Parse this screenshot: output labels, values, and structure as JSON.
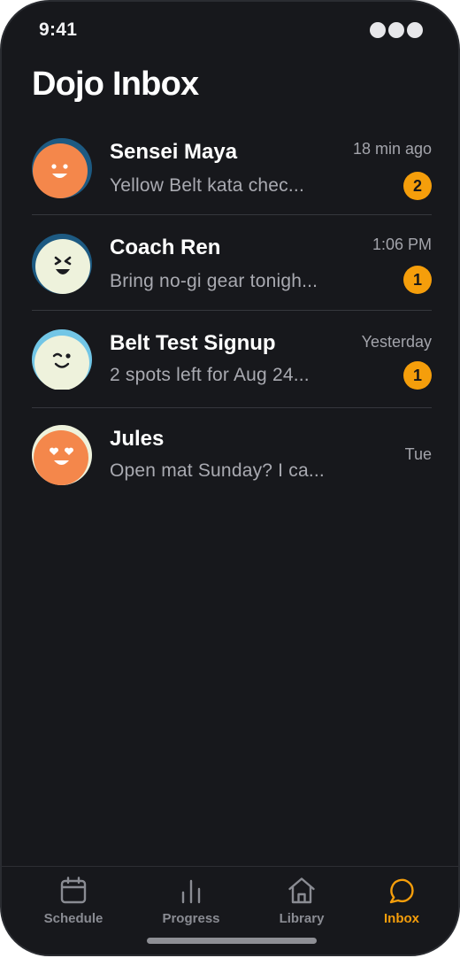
{
  "status_bar": {
    "time": "9:41"
  },
  "header": {
    "title": "Dojo Inbox"
  },
  "conversations": [
    {
      "name": "Sensei Maya",
      "preview": "Yellow Belt kata chec...",
      "time": "18 min ago",
      "unread": "2",
      "avatar": "smiling-face-icon"
    },
    {
      "name": "Coach Ren",
      "preview": "Bring no-gi gear tonigh...",
      "time": "1:06 PM",
      "unread": "1",
      "avatar": "laughing-face-icon"
    },
    {
      "name": "Belt Test Signup",
      "preview": "2 spots left for Aug 24...",
      "time": "Yesterday",
      "unread": "1",
      "avatar": "winking-face-icon"
    },
    {
      "name": "Jules",
      "preview": "Open mat Sunday? I ca...",
      "time": "Tue",
      "unread": "",
      "avatar": "heart-eyes-face-icon"
    }
  ],
  "tabbar": {
    "tabs": [
      {
        "label": "Schedule",
        "icon": "calendar-icon",
        "active": false
      },
      {
        "label": "Progress",
        "icon": "bar-chart-icon",
        "active": false
      },
      {
        "label": "Library",
        "icon": "home-icon",
        "active": false
      },
      {
        "label": "Inbox",
        "icon": "chat-bubble-icon",
        "active": true
      }
    ]
  },
  "colors": {
    "background": "#17181c",
    "accent": "#f59e0b",
    "avatar_orange": "#f4874b",
    "avatar_cream": "#eef2dc",
    "avatar_ring_navy": "#1d5a82",
    "avatar_ring_sky": "#72c6e6"
  }
}
